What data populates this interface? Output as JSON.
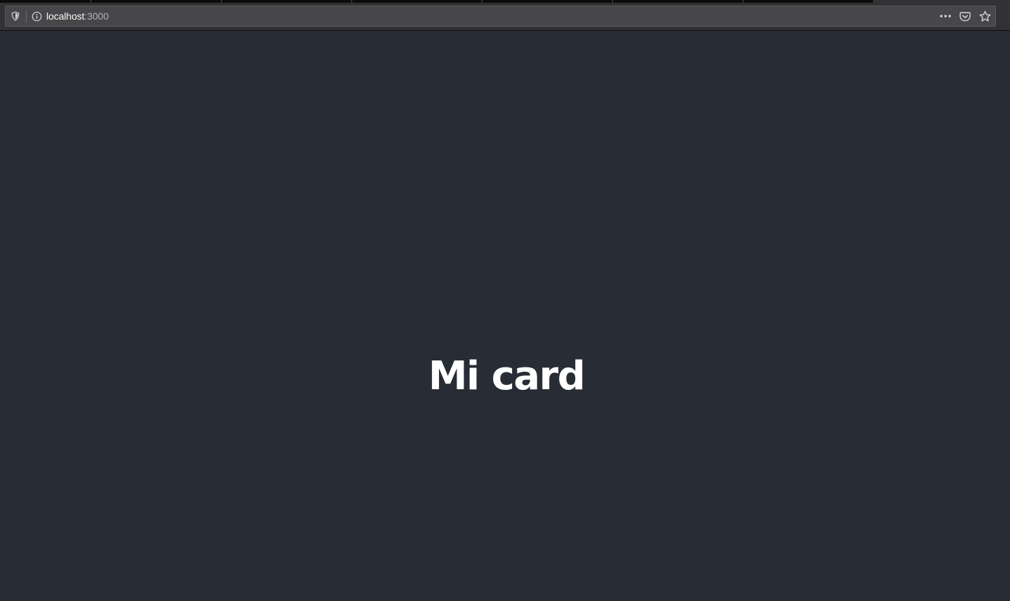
{
  "browser": {
    "url_host": "localhost",
    "url_port": ":3000",
    "icons": [
      "shield-icon",
      "info-icon",
      "more-icon",
      "pocket-icon",
      "star-icon"
    ]
  },
  "page": {
    "heading": "Mi card",
    "background_color": "#282c34",
    "text_color": "#ffffff"
  }
}
